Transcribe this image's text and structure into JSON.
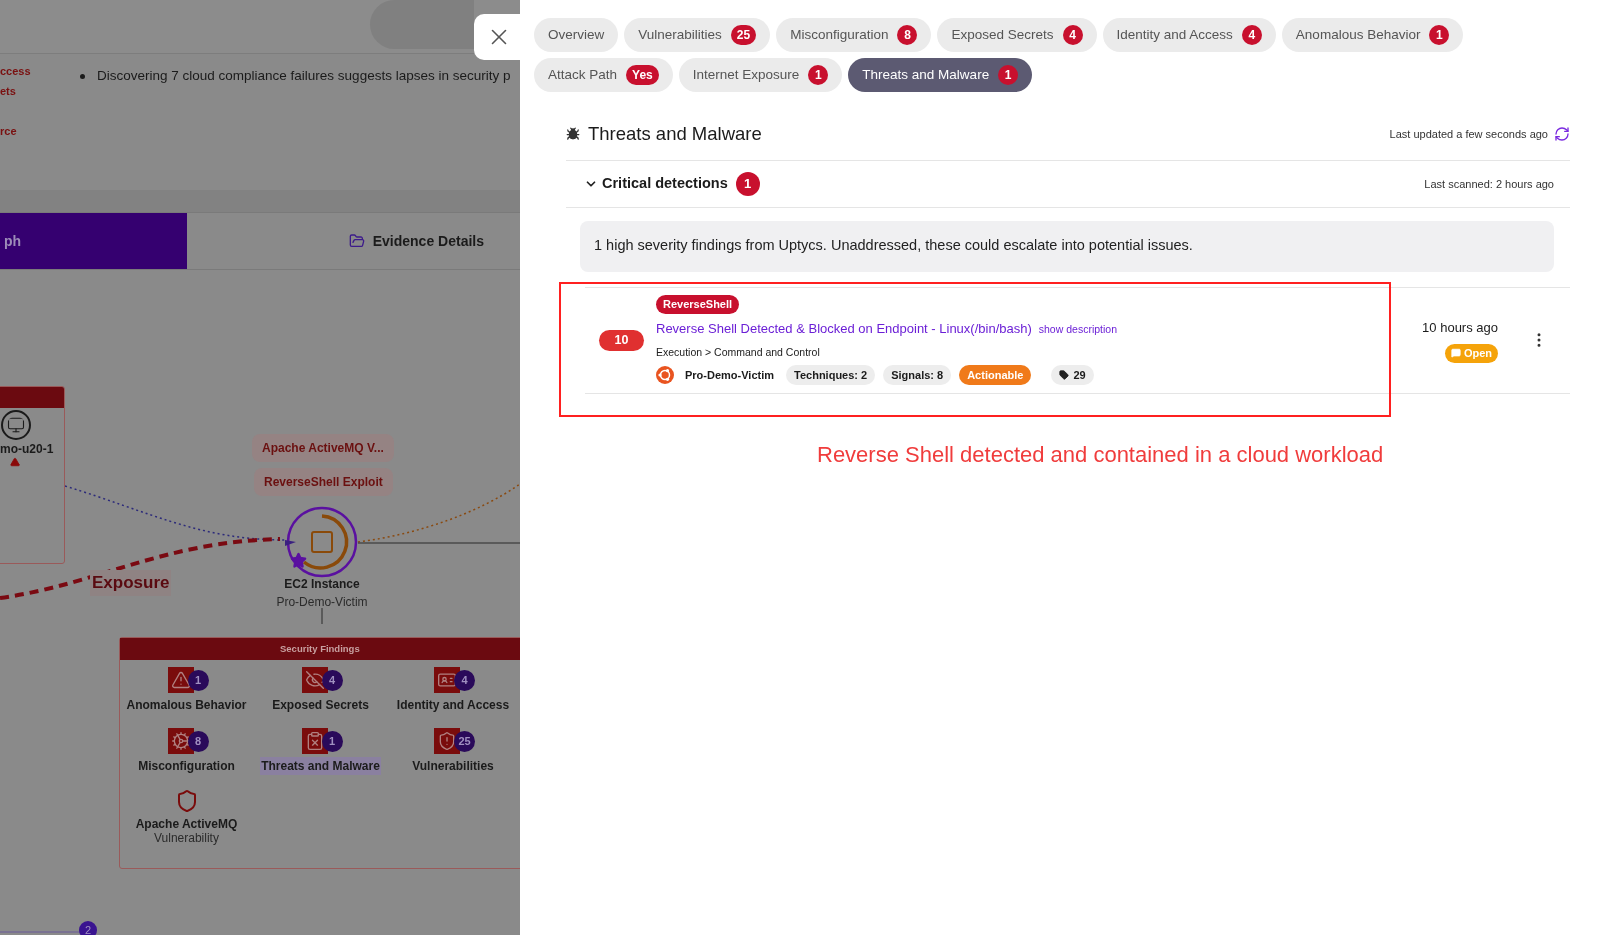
{
  "background": {
    "bullets": [
      "Discovering 7 cloud compliance failures suggests lapses in security p"
    ],
    "side_labels": [
      "ccess",
      "ets",
      "rce"
    ],
    "view_tabs": [
      {
        "label": "ph",
        "selected": true
      },
      {
        "label": "Evidence Details",
        "selected": false
      }
    ],
    "graph": {
      "host_label": "mo-u20-1",
      "tags": [
        "Apache ActiveMQ V...",
        "ReverseShell Exploit"
      ],
      "edge_label": "Exposure",
      "node_title": "EC2 Instance",
      "node_subtitle": "Pro-Demo-Victim",
      "findings_title": "Security Findings",
      "findings": [
        {
          "label": "Anomalous Behavior",
          "count": "1",
          "selected": false
        },
        {
          "label": "Exposed Secrets",
          "count": "4",
          "selected": false
        },
        {
          "label": "Identity and Access",
          "count": "4",
          "selected": false
        },
        {
          "label": "Misconfiguration",
          "count": "8",
          "selected": false
        },
        {
          "label": "Threats and Malware",
          "count": "1",
          "selected": true
        },
        {
          "label": "Vulnerabilities",
          "count": "25",
          "selected": false
        }
      ],
      "vulnerability": {
        "title": "Apache ActiveMQ",
        "subtitle": "Vulnerability"
      },
      "page_badge": "2"
    }
  },
  "drawer": {
    "tabs": [
      {
        "label": "Overview",
        "selected": false
      },
      {
        "label": "Vulnerabilities",
        "count": "25",
        "selected": false
      },
      {
        "label": "Misconfiguration",
        "count": "8",
        "selected": false
      },
      {
        "label": "Exposed Secrets",
        "count": "4",
        "selected": false
      },
      {
        "label": "Identity and Access",
        "count": "4",
        "selected": false
      },
      {
        "label": "Anomalous Behavior",
        "count": "1",
        "selected": false
      },
      {
        "label": "Attack Path",
        "count": "Yes",
        "selected": false
      },
      {
        "label": "Internet Exposure",
        "count": "1",
        "selected": false
      },
      {
        "label": "Threats and Malware",
        "count": "1",
        "selected": true
      }
    ],
    "title": "Threats and Malware",
    "last_updated": "Last updated a few seconds ago",
    "section": {
      "title": "Critical detections",
      "count": "1",
      "expanded": true,
      "last_scanned": "Last scanned: 2 hours ago"
    },
    "summary": "1 high severity findings from Uptycs. Unaddressed, these could escalate into potential issues.",
    "detections": [
      {
        "score": "10",
        "tag": "ReverseShell",
        "title": "Reverse Shell Detected & Blocked on Endpoint - Linux(/bin/bash)",
        "link": "show description",
        "tactic": "Execution > Command and Control",
        "host": "Pro-Demo-Victim",
        "chips": [
          "Techniques: 2",
          "Signals: 8"
        ],
        "status_tag": "Actionable",
        "tag_count": "29",
        "time": "10 hours ago",
        "state": "Open"
      }
    ],
    "annotation": "Reverse Shell detected and contained in a cloud workload"
  }
}
